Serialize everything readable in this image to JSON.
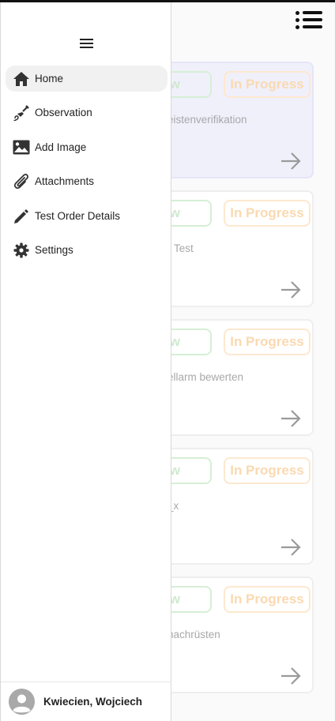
{
  "background": {
    "cards": [
      {
        "status_new": "New",
        "status_progress": "In Progress",
        "title": "Leistenverifikation",
        "visible_title": "eistenverifikation",
        "highlighted": true
      },
      {
        "status_new": "New",
        "status_progress": "In Progress",
        "title": "r Test",
        "visible_title": "r Test",
        "highlighted": false
      },
      {
        "status_new": "New",
        "status_progress": "In Progress",
        "title": "ellarm bewerten",
        "visible_title": "ellarm bewerten",
        "highlighted": false
      },
      {
        "status_new": "New",
        "status_progress": "In Progress",
        "title": "_x",
        "visible_title": "_x",
        "highlighted": false
      },
      {
        "status_new": "New",
        "status_progress": "In Progress",
        "title": "nachrüsten",
        "visible_title": "nachrüsten",
        "highlighted": false
      }
    ]
  },
  "drawer": {
    "items": [
      {
        "label": "Home",
        "icon": "home-icon",
        "active": true
      },
      {
        "label": "Observation",
        "icon": "observation-icon",
        "active": false
      },
      {
        "label": "Add Image",
        "icon": "image-icon",
        "active": false
      },
      {
        "label": "Attachments",
        "icon": "paperclip-icon",
        "active": false
      },
      {
        "label": "Test Order Details",
        "icon": "pencil-icon",
        "active": false
      },
      {
        "label": "Settings",
        "icon": "gear-icon",
        "active": false
      }
    ],
    "user": {
      "name": "Kwiecien, Wojciech"
    }
  },
  "colors": {
    "badge_new": "#cfe9cf",
    "badge_progress": "#fad9b1",
    "highlight_card": "#f0f0fb"
  }
}
